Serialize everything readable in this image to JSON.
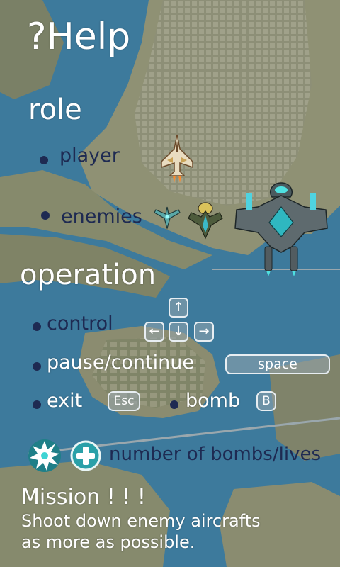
{
  "title": "?Help",
  "role": {
    "heading": "role",
    "player_label": "player",
    "enemies_label": "enemies"
  },
  "operation": {
    "heading": "operation",
    "control_label": "control",
    "control_keys": [
      "↑",
      "←",
      "↓",
      "→"
    ],
    "pause_label": "pause/continue",
    "pause_key": "space",
    "exit_label": "exit",
    "exit_key": "Esc",
    "bomb_label": "bomb",
    "bomb_key": "B"
  },
  "bombs_lives_label": "number of bombs/lives",
  "mission": {
    "heading": "Mission ! ! !",
    "text_line1": "Shoot down enemy aircrafts",
    "text_line2": "as more as possible."
  },
  "icons": [
    "burst-bomb-icon",
    "plus-life-icon",
    "player-jet-icon",
    "small-enemy-jet-icon",
    "medium-enemy-jet-icon",
    "boss-aircraft-icon"
  ],
  "colors": {
    "text": "#ffffff",
    "bullet": "#1e2a52",
    "sea": "#3f7fa0",
    "land": "#8a8f6f"
  }
}
